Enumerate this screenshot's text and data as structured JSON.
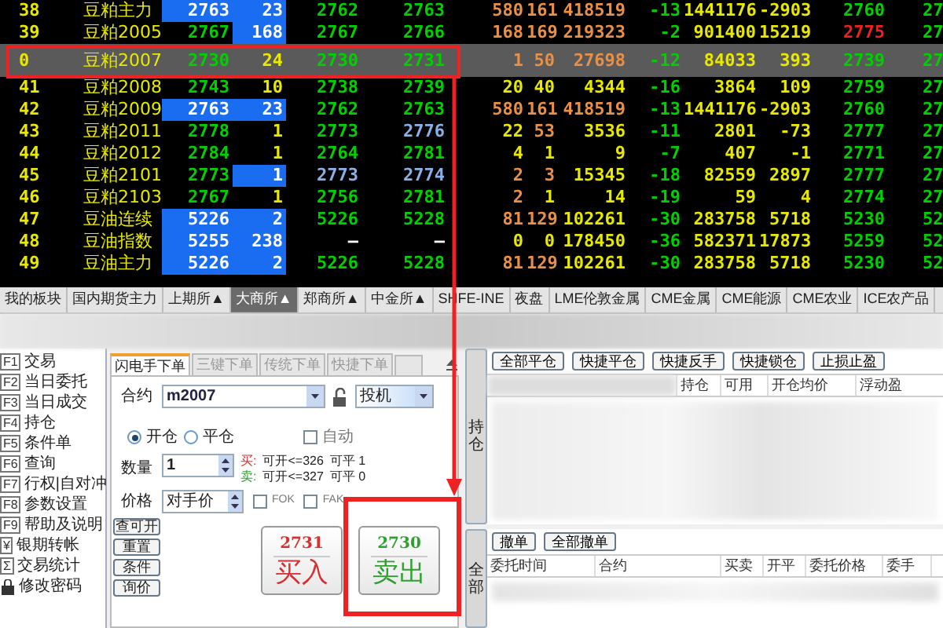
{
  "quotes": [
    {
      "index": "38",
      "name": "豆粕主力",
      "selected": false,
      "cells": [
        {
          "text": "2763",
          "kind": "b"
        },
        {
          "text": "23",
          "kind": "b"
        },
        {
          "text": "2762",
          "kind": "g"
        },
        {
          "text": "2763",
          "kind": "g"
        },
        {
          "text": "580",
          "kind": "o"
        },
        {
          "text": "161",
          "kind": "o"
        },
        {
          "text": "418519",
          "kind": "o"
        },
        {
          "text": "-13",
          "kind": "g"
        },
        {
          "text": "1441176",
          "kind": "y"
        },
        {
          "text": "-2903",
          "kind": "y"
        },
        {
          "text": "2760",
          "kind": "g"
        },
        {
          "text": "27",
          "kind": "g"
        }
      ]
    },
    {
      "index": "39",
      "name": "豆粕2005",
      "selected": false,
      "cells": [
        {
          "text": "2767",
          "kind": "g"
        },
        {
          "text": "168",
          "kind": "b"
        },
        {
          "text": "2767",
          "kind": "g"
        },
        {
          "text": "2766",
          "kind": "g"
        },
        {
          "text": "168",
          "kind": "o"
        },
        {
          "text": "169",
          "kind": "o"
        },
        {
          "text": "219323",
          "kind": "o"
        },
        {
          "text": "-2",
          "kind": "g"
        },
        {
          "text": "901400",
          "kind": "y"
        },
        {
          "text": "15219",
          "kind": "y"
        },
        {
          "text": "2775",
          "kind": "r"
        },
        {
          "text": "27",
          "kind": "g"
        }
      ]
    },
    {
      "index": "0",
      "name": "豆粕2007",
      "selected": true,
      "cells": [
        {
          "text": "2730",
          "kind": "g"
        },
        {
          "text": "24",
          "kind": "y"
        },
        {
          "text": "2730",
          "kind": "g"
        },
        {
          "text": "2731",
          "kind": "g"
        },
        {
          "text": "1",
          "kind": "o"
        },
        {
          "text": "50",
          "kind": "o"
        },
        {
          "text": "27698",
          "kind": "o"
        },
        {
          "text": "-12",
          "kind": "g"
        },
        {
          "text": "84033",
          "kind": "y"
        },
        {
          "text": "393",
          "kind": "y"
        },
        {
          "text": "2739",
          "kind": "g"
        },
        {
          "text": "27",
          "kind": "g"
        }
      ]
    },
    {
      "index": "41",
      "name": "豆粕2008",
      "selected": false,
      "cells": [
        {
          "text": "2743",
          "kind": "g"
        },
        {
          "text": "10",
          "kind": "y"
        },
        {
          "text": "2738",
          "kind": "g"
        },
        {
          "text": "2739",
          "kind": "g"
        },
        {
          "text": "20",
          "kind": "y"
        },
        {
          "text": "40",
          "kind": "y"
        },
        {
          "text": "4344",
          "kind": "y"
        },
        {
          "text": "-16",
          "kind": "g"
        },
        {
          "text": "3864",
          "kind": "y"
        },
        {
          "text": "109",
          "kind": "y"
        },
        {
          "text": "2759",
          "kind": "g"
        },
        {
          "text": "27",
          "kind": "g"
        }
      ]
    },
    {
      "index": "42",
      "name": "豆粕2009",
      "selected": false,
      "cells": [
        {
          "text": "2763",
          "kind": "b"
        },
        {
          "text": "23",
          "kind": "b"
        },
        {
          "text": "2762",
          "kind": "g"
        },
        {
          "text": "2763",
          "kind": "g"
        },
        {
          "text": "580",
          "kind": "o"
        },
        {
          "text": "161",
          "kind": "o"
        },
        {
          "text": "418519",
          "kind": "o"
        },
        {
          "text": "-13",
          "kind": "g"
        },
        {
          "text": "1441176",
          "kind": "y"
        },
        {
          "text": "-2903",
          "kind": "y"
        },
        {
          "text": "2760",
          "kind": "g"
        },
        {
          "text": "27",
          "kind": "g"
        }
      ]
    },
    {
      "index": "43",
      "name": "豆粕2011",
      "selected": false,
      "cells": [
        {
          "text": "2778",
          "kind": "g"
        },
        {
          "text": "1",
          "kind": "y"
        },
        {
          "text": "2773",
          "kind": "g"
        },
        {
          "text": "2776",
          "kind": "s"
        },
        {
          "text": "22",
          "kind": "y"
        },
        {
          "text": "53",
          "kind": "o"
        },
        {
          "text": "3536",
          "kind": "y"
        },
        {
          "text": "-11",
          "kind": "g"
        },
        {
          "text": "2801",
          "kind": "y"
        },
        {
          "text": "-73",
          "kind": "y"
        },
        {
          "text": "2777",
          "kind": "g"
        },
        {
          "text": "27",
          "kind": "g"
        }
      ]
    },
    {
      "index": "44",
      "name": "豆粕2012",
      "selected": false,
      "cells": [
        {
          "text": "2784",
          "kind": "g"
        },
        {
          "text": "1",
          "kind": "y"
        },
        {
          "text": "2764",
          "kind": "g"
        },
        {
          "text": "2781",
          "kind": "g"
        },
        {
          "text": "4",
          "kind": "y"
        },
        {
          "text": "1",
          "kind": "y"
        },
        {
          "text": "9",
          "kind": "y"
        },
        {
          "text": "-7",
          "kind": "g"
        },
        {
          "text": "407",
          "kind": "y"
        },
        {
          "text": "-1",
          "kind": "y"
        },
        {
          "text": "2771",
          "kind": "g"
        },
        {
          "text": "27",
          "kind": "g"
        }
      ]
    },
    {
      "index": "45",
      "name": "豆粕2101",
      "selected": false,
      "cells": [
        {
          "text": "2773",
          "kind": "g"
        },
        {
          "text": "1",
          "kind": "b"
        },
        {
          "text": "2773",
          "kind": "s"
        },
        {
          "text": "2774",
          "kind": "s"
        },
        {
          "text": "2",
          "kind": "o"
        },
        {
          "text": "3",
          "kind": "o"
        },
        {
          "text": "15345",
          "kind": "y"
        },
        {
          "text": "-18",
          "kind": "g"
        },
        {
          "text": "82559",
          "kind": "y"
        },
        {
          "text": "2897",
          "kind": "y"
        },
        {
          "text": "2777",
          "kind": "g"
        },
        {
          "text": "27",
          "kind": "g"
        }
      ]
    },
    {
      "index": "46",
      "name": "豆粕2103",
      "selected": false,
      "cells": [
        {
          "text": "2767",
          "kind": "g"
        },
        {
          "text": "1",
          "kind": "y"
        },
        {
          "text": "2756",
          "kind": "g"
        },
        {
          "text": "2781",
          "kind": "g"
        },
        {
          "text": "2",
          "kind": "o"
        },
        {
          "text": "1",
          "kind": "y"
        },
        {
          "text": "14",
          "kind": "y"
        },
        {
          "text": "-19",
          "kind": "g"
        },
        {
          "text": "59",
          "kind": "y"
        },
        {
          "text": "4",
          "kind": "y"
        },
        {
          "text": "2774",
          "kind": "g"
        },
        {
          "text": "27",
          "kind": "g"
        }
      ]
    },
    {
      "index": "47",
      "name": "豆油连续",
      "selected": false,
      "cells": [
        {
          "text": "5226",
          "kind": "b"
        },
        {
          "text": "2",
          "kind": "b"
        },
        {
          "text": "5226",
          "kind": "g"
        },
        {
          "text": "5228",
          "kind": "g"
        },
        {
          "text": "81",
          "kind": "o"
        },
        {
          "text": "129",
          "kind": "o"
        },
        {
          "text": "102261",
          "kind": "y"
        },
        {
          "text": "-30",
          "kind": "g"
        },
        {
          "text": "283758",
          "kind": "y"
        },
        {
          "text": "5718",
          "kind": "y"
        },
        {
          "text": "5230",
          "kind": "g"
        },
        {
          "text": "52",
          "kind": "g"
        }
      ]
    },
    {
      "index": "48",
      "name": "豆油指数",
      "selected": false,
      "cells": [
        {
          "text": "5255",
          "kind": "b"
        },
        {
          "text": "238",
          "kind": "b"
        },
        {
          "text": "—",
          "kind": "w"
        },
        {
          "text": "—",
          "kind": "w"
        },
        {
          "text": "0",
          "kind": "y"
        },
        {
          "text": "0",
          "kind": "y"
        },
        {
          "text": "178450",
          "kind": "y"
        },
        {
          "text": "-36",
          "kind": "g"
        },
        {
          "text": "582371",
          "kind": "y"
        },
        {
          "text": "17873",
          "kind": "y"
        },
        {
          "text": "5259",
          "kind": "g"
        },
        {
          "text": "52",
          "kind": "g"
        }
      ]
    },
    {
      "index": "49",
      "name": "豆油主力",
      "selected": false,
      "cells": [
        {
          "text": "5226",
          "kind": "b"
        },
        {
          "text": "2",
          "kind": "b"
        },
        {
          "text": "5226",
          "kind": "g"
        },
        {
          "text": "5228",
          "kind": "g"
        },
        {
          "text": "81",
          "kind": "o"
        },
        {
          "text": "129",
          "kind": "o"
        },
        {
          "text": "102261",
          "kind": "y"
        },
        {
          "text": "-30",
          "kind": "g"
        },
        {
          "text": "283758",
          "kind": "y"
        },
        {
          "text": "5718",
          "kind": "y"
        },
        {
          "text": "5230",
          "kind": "g"
        },
        {
          "text": "52",
          "kind": "g"
        }
      ]
    }
  ],
  "exchange_tabs": [
    {
      "label": "我的板块",
      "selected": false
    },
    {
      "label": "国内期货主力",
      "selected": false
    },
    {
      "label": "上期所▲",
      "selected": false
    },
    {
      "label": "大商所▲",
      "selected": true
    },
    {
      "label": "郑商所▲",
      "selected": false
    },
    {
      "label": "中金所▲",
      "selected": false
    },
    {
      "label": "SHFE-INE",
      "selected": false
    },
    {
      "label": "夜盘",
      "selected": false
    },
    {
      "label": "LME伦敦金属",
      "selected": false
    },
    {
      "label": "CME金属",
      "selected": false
    },
    {
      "label": "CME能源",
      "selected": false
    },
    {
      "label": "CME农业",
      "selected": false
    },
    {
      "label": "ICE农产品",
      "selected": false
    }
  ],
  "functions": [
    {
      "key": "F1",
      "label": "交易"
    },
    {
      "key": "F2",
      "label": "当日委托"
    },
    {
      "key": "F3",
      "label": "当日成交"
    },
    {
      "key": "F4",
      "label": "持仓"
    },
    {
      "key": "F5",
      "label": "条件单"
    },
    {
      "key": "F6",
      "label": "查询"
    },
    {
      "key": "F7",
      "label": "行权|自对冲"
    },
    {
      "key": "F8",
      "label": "参数设置"
    },
    {
      "key": "F9",
      "label": "帮助及说明"
    },
    {
      "key": "¥",
      "label": "银期转帐"
    },
    {
      "key": "Σ",
      "label": "交易统计"
    },
    {
      "label": "修改密码"
    }
  ],
  "order_tabs": [
    {
      "label": "闪电手下单",
      "selected": true
    },
    {
      "label": "三键下单",
      "selected": false
    },
    {
      "label": "传统下单",
      "selected": false
    },
    {
      "label": "快捷下单",
      "selected": false
    }
  ],
  "order_form": {
    "contract_label": "合约",
    "contract": "m2007",
    "hedge": "投机",
    "open_label": "开仓",
    "close_label": "平仓",
    "open_selected": true,
    "auto_label": "自动",
    "auto": false,
    "qty_label": "数量",
    "qty": "1",
    "buy_info": {
      "side": "买:",
      "open": "可开<=326",
      "close": "可平 1"
    },
    "sell_info": {
      "side": "卖:",
      "open": "可开<=327",
      "close": "可平 0"
    },
    "price_label": "价格",
    "price": "对手价",
    "fok_label": "FOK",
    "fok": false,
    "fak_label": "FAK",
    "fak": false,
    "small_buttons": [
      "查可开",
      "重置",
      "条件",
      "询价"
    ],
    "buy": {
      "price": "2731",
      "label": "买入"
    },
    "sell": {
      "price": "2730",
      "label": "卖出"
    }
  },
  "positions": {
    "tab": "持仓",
    "buttons": [
      "全部平仓",
      "快捷平仓",
      "快捷反手",
      "快捷锁仓",
      "止损止盈"
    ],
    "columns": [
      "持仓",
      "可用",
      "开仓均价",
      "浮动盈"
    ]
  },
  "orders": {
    "tab": "全部",
    "buttons": [
      "撤单",
      "全部撤单"
    ],
    "columns": [
      "委托时间",
      "合约",
      "买卖",
      "开平",
      "委托价格",
      "委手"
    ]
  }
}
